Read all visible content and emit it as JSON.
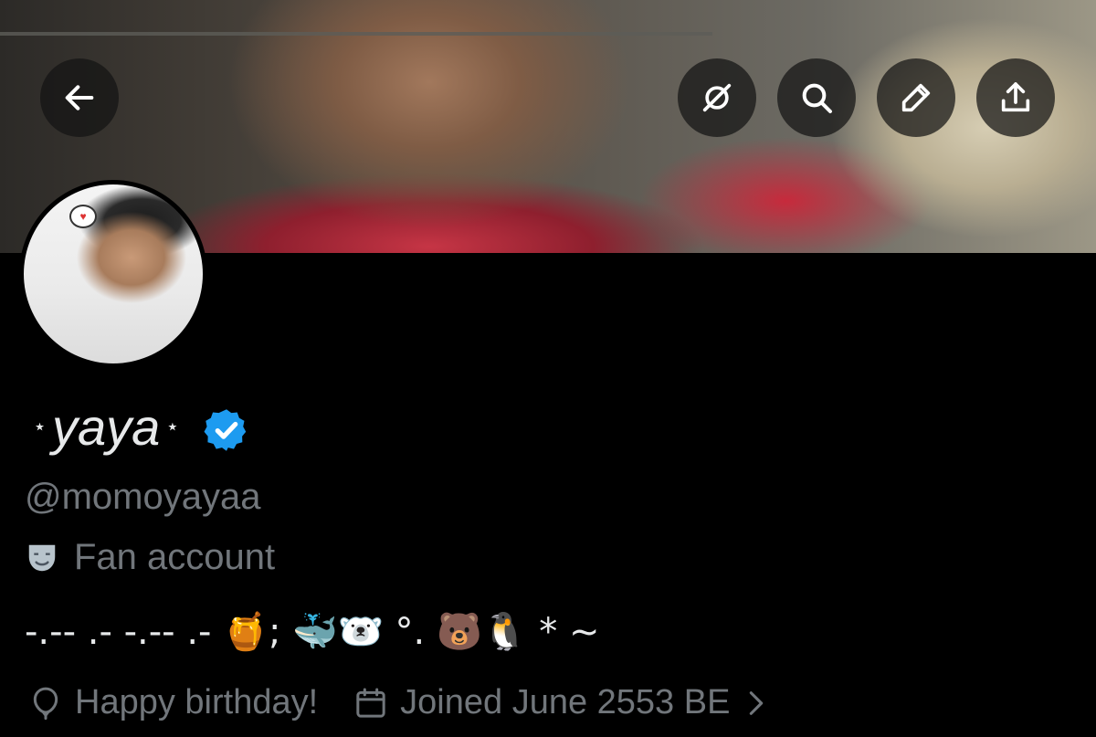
{
  "header": {
    "buttons": [
      {
        "name": "back-button",
        "icon": "arrow-left-icon"
      },
      {
        "name": "hide-button",
        "icon": "eye-slash-icon"
      },
      {
        "name": "search-button",
        "icon": "search-icon"
      },
      {
        "name": "edit-button",
        "icon": "pencil-icon"
      },
      {
        "name": "share-button",
        "icon": "share-icon"
      }
    ]
  },
  "profile": {
    "name": "yaya",
    "name_deco": "⋆",
    "verified_color": "#1d9bf0",
    "handle": "@momoyayaa",
    "category": "Fan account",
    "bio": "-.-- .- -.-- .- 🍯; 🐳🐻‍❄️ °. 🐻🐧 * ~",
    "birthday_text": "Happy birthday!",
    "joined_text": "Joined June 2553 BE"
  },
  "colors": {
    "background": "#000000",
    "primary_text": "#e7e9ea",
    "secondary_text": "#71767b",
    "accent": "#1d9bf0"
  }
}
